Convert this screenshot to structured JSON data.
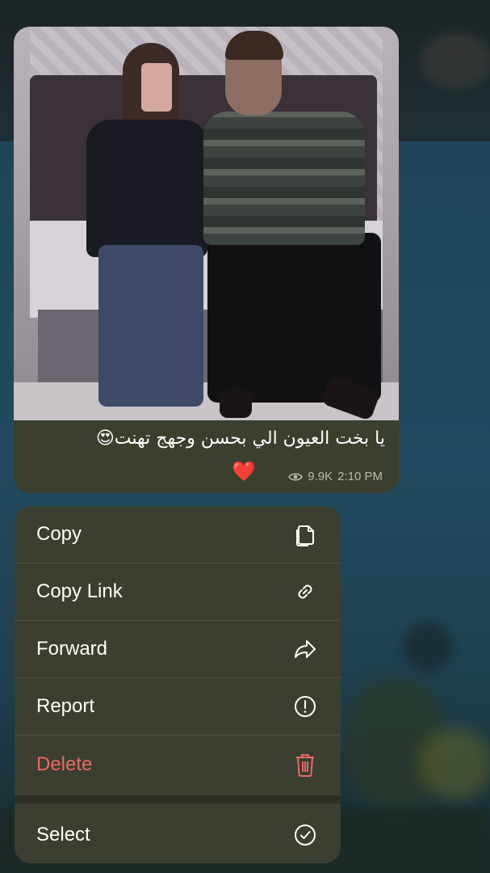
{
  "message": {
    "caption": "يا بخت العيون الي بحسن وجهج تهنت😍",
    "caption_heart": "❤️",
    "views": "9.9K",
    "time": "2:10 PM"
  },
  "menu": {
    "items": [
      {
        "label": "Copy",
        "icon": "copy-icon"
      },
      {
        "label": "Copy Link",
        "icon": "link-icon"
      },
      {
        "label": "Forward",
        "icon": "forward-icon"
      },
      {
        "label": "Report",
        "icon": "report-icon"
      },
      {
        "label": "Delete",
        "icon": "trash-icon",
        "color": "#ea6a64"
      },
      {
        "label": "Select",
        "icon": "select-icon"
      }
    ]
  }
}
